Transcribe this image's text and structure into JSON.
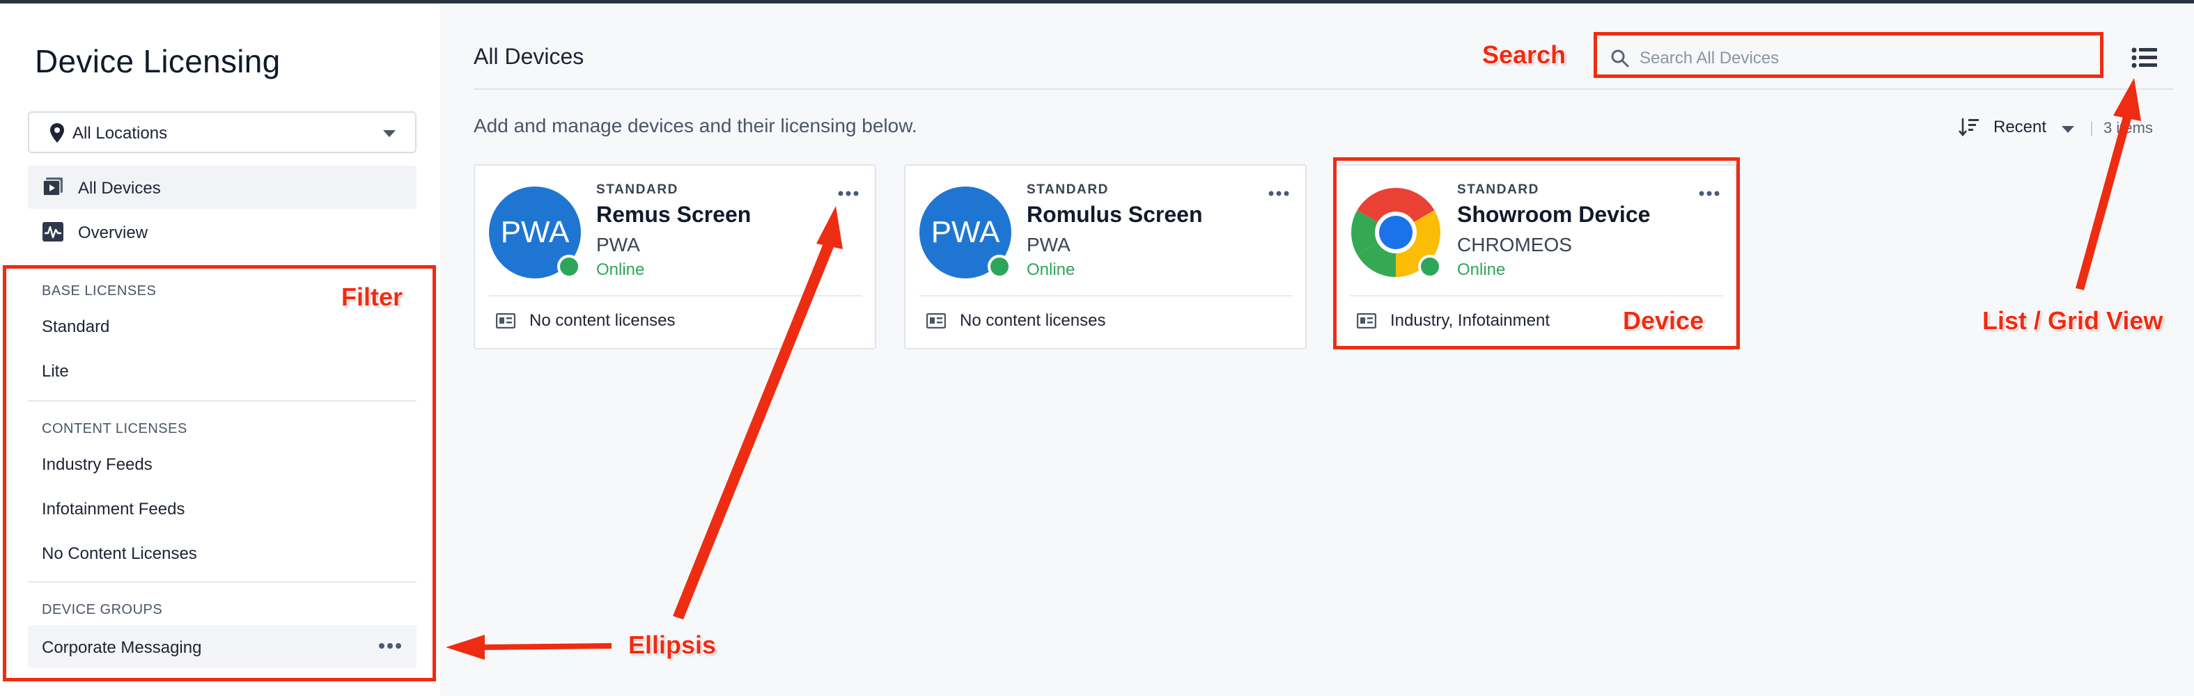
{
  "sidebar": {
    "title": "Device Licensing",
    "location_select": {
      "value": "All Locations"
    },
    "nav": [
      {
        "label": "All Devices",
        "icon": "play-screen-icon",
        "active": true
      },
      {
        "label": "Overview",
        "icon": "activity-icon",
        "active": false
      }
    ],
    "base_licenses": {
      "heading": "BASE LICENSES",
      "items": [
        "Standard",
        "Lite"
      ]
    },
    "content_licenses": {
      "heading": "CONTENT LICENSES",
      "items": [
        "Industry Feeds",
        "Infotainment Feeds",
        "No Content Licenses"
      ]
    },
    "device_groups": {
      "heading": "DEVICE GROUPS",
      "items": [
        "Corporate Messaging"
      ]
    }
  },
  "main": {
    "title": "All Devices",
    "subtitle": "Add and manage devices and their licensing below.",
    "search": {
      "placeholder": "Search All Devices",
      "value": ""
    },
    "sort": {
      "label": "Recent"
    },
    "items_count": "3 items",
    "devices": [
      {
        "tier": "STANDARD",
        "name": "Remus Screen",
        "platform": "PWA",
        "status": "Online",
        "avatar_text": "PWA",
        "avatar": "pwa-avatar",
        "licenses": "No content licenses"
      },
      {
        "tier": "STANDARD",
        "name": "Romulus Screen",
        "platform": "PWA",
        "status": "Online",
        "avatar_text": "PWA",
        "avatar": "pwa-avatar",
        "licenses": "No content licenses"
      },
      {
        "tier": "STANDARD",
        "name": "Showroom Device",
        "platform": "CHROMEOS",
        "status": "Online",
        "avatar_text": "",
        "avatar": "chrome-logo",
        "licenses": "Industry, Infotainment"
      }
    ]
  },
  "annotations": {
    "search": "Search",
    "filter": "Filter",
    "device": "Device",
    "view": "List / Grid View",
    "ellipsis": "Ellipsis"
  },
  "colors": {
    "accent_blue": "#1f76d2",
    "online_green": "#2ea65a",
    "annotation_red": "#ee2c12",
    "main_bg": "#f7f8fa"
  }
}
